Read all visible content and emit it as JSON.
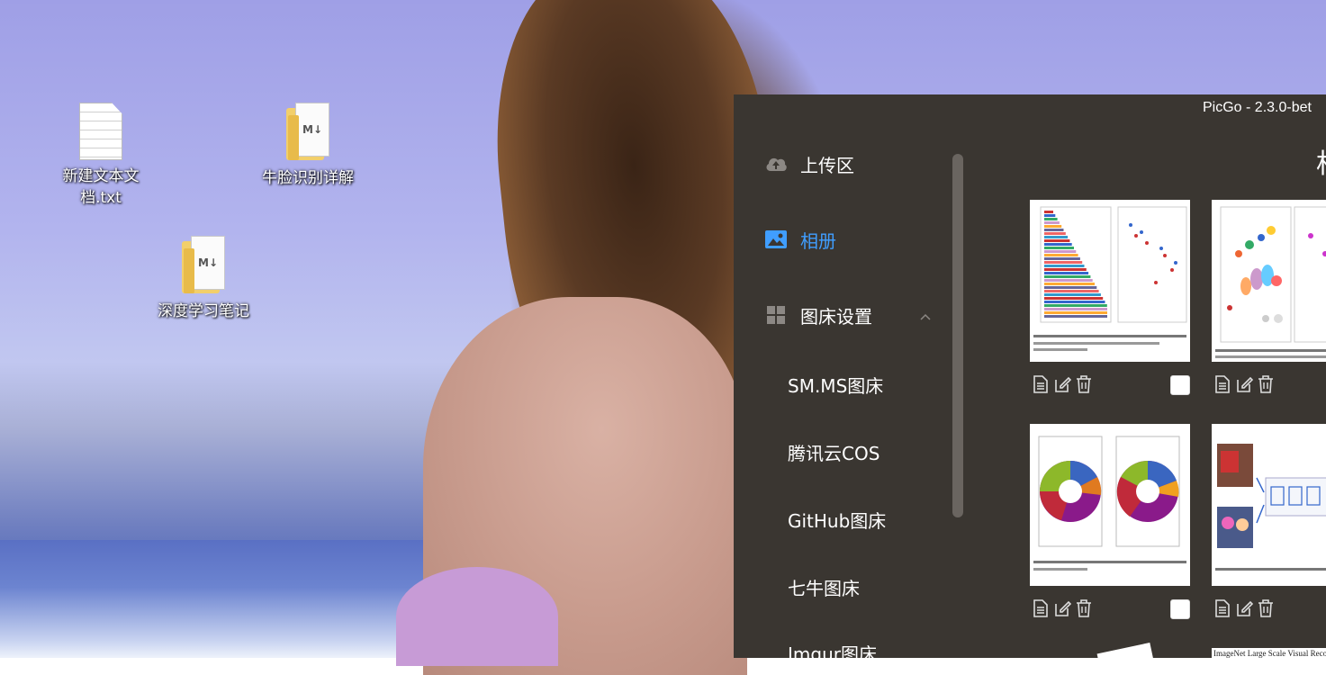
{
  "desktop": {
    "icons": [
      {
        "label_line1": "新建文本文",
        "label_line2": "档.txt",
        "icon": "text-file-icon"
      },
      {
        "label": "牛脸识别详解",
        "icon": "markdown-file-icon"
      },
      {
        "label": "深度学习笔记",
        "icon": "markdown-file-icon"
      }
    ],
    "md_badge": "M↓"
  },
  "picgo": {
    "window_title": "PicGo - 2.3.0-bet",
    "page_title": "相",
    "menu": {
      "upload": "上传区",
      "gallery": "相册",
      "settings": "图床设置",
      "sub_items": [
        "SM.MS图床",
        "腾讯云COS",
        "GitHub图床",
        "七牛图床",
        "Imgur图床"
      ]
    },
    "active_color": "#409eff",
    "sidebar_bg": "#3a3631",
    "thumbnails": [
      {
        "name": "thumb-bar-chart-paper"
      },
      {
        "name": "thumb-bubble-chart-paper"
      },
      {
        "name": "thumb-donut-charts-paper"
      },
      {
        "name": "thumb-mobilenets-figure"
      }
    ],
    "partial_caption": "ImageNet Large Scale Visual Recognition Challenge ("
  }
}
